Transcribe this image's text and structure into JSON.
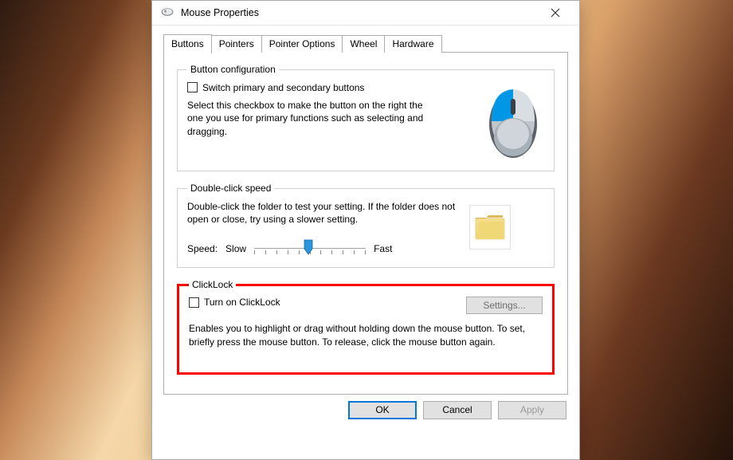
{
  "window": {
    "title": "Mouse Properties"
  },
  "tabs": {
    "buttons": "Buttons",
    "pointers": "Pointers",
    "pointer_options": "Pointer Options",
    "wheel": "Wheel",
    "hardware": "Hardware"
  },
  "button_config": {
    "legend": "Button configuration",
    "checkbox_label": "Switch primary and secondary buttons",
    "desc": "Select this checkbox to make the button on the right the one you use for primary functions such as selecting and dragging."
  },
  "double_click": {
    "legend": "Double-click speed",
    "desc": "Double-click the folder to test your setting. If the folder does not open or close, try using a slower setting.",
    "speed_label": "Speed:",
    "slow": "Slow",
    "fast": "Fast"
  },
  "clicklock": {
    "legend": "ClickLock",
    "checkbox_label": "Turn on ClickLock",
    "settings_btn": "Settings...",
    "desc": "Enables you to highlight or drag without holding down the mouse button. To set, briefly press the mouse button. To release, click the mouse button again."
  },
  "buttons_row": {
    "ok": "OK",
    "cancel": "Cancel",
    "apply": "Apply"
  }
}
